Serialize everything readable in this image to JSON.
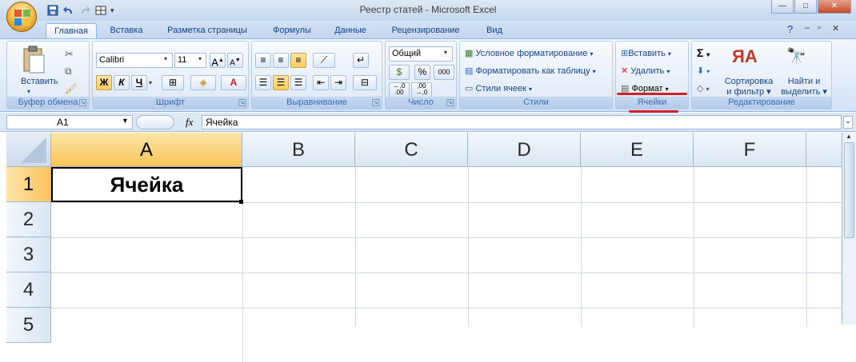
{
  "window": {
    "title": "Реестр статей - Microsoft Excel"
  },
  "tabs": [
    "Главная",
    "Вставка",
    "Разметка страницы",
    "Формулы",
    "Данные",
    "Рецензирование",
    "Вид"
  ],
  "ribbon": {
    "clipboard": {
      "label": "Буфер обмена",
      "paste": "Вставить"
    },
    "font": {
      "label": "Шрифт",
      "font_name": "Calibri",
      "font_size": "11",
      "bold": "Ж",
      "italic": "К",
      "underline": "Ч",
      "grow": "A",
      "shrink": "A",
      "color_letter": "A"
    },
    "alignment": {
      "label": "Выравнивание"
    },
    "number": {
      "label": "Число",
      "format": "Общий",
      "percent": "%",
      "thousands": "000",
      "inc_dec": "←,0 .00",
      "dec_dec": ",00 →,0"
    },
    "styles": {
      "label": "Стили",
      "conditional": "Условное форматирование",
      "as_table": "Форматировать как таблицу",
      "cell_styles": "Стили ячеек"
    },
    "cells": {
      "label": "Ячейки",
      "insert": "Вставить",
      "delete": "Удалить",
      "format": "Формат"
    },
    "editing": {
      "label": "Редактирование",
      "sigma": "Σ",
      "sort": "Сортировка",
      "sort2": "и фильтр",
      "find": "Найти и",
      "find2": "выделить"
    }
  },
  "formula_bar": {
    "name_box": "A1",
    "fx": "fx",
    "content": "Ячейка"
  },
  "sheet": {
    "columns": [
      "A",
      "B",
      "C",
      "D",
      "E",
      "F"
    ],
    "rows": [
      "1",
      "2",
      "3",
      "4",
      "5"
    ],
    "a1_value": "Ячейка"
  },
  "colors": {
    "accent_red": "#d0202a",
    "selected_header": "#f9c35a"
  }
}
